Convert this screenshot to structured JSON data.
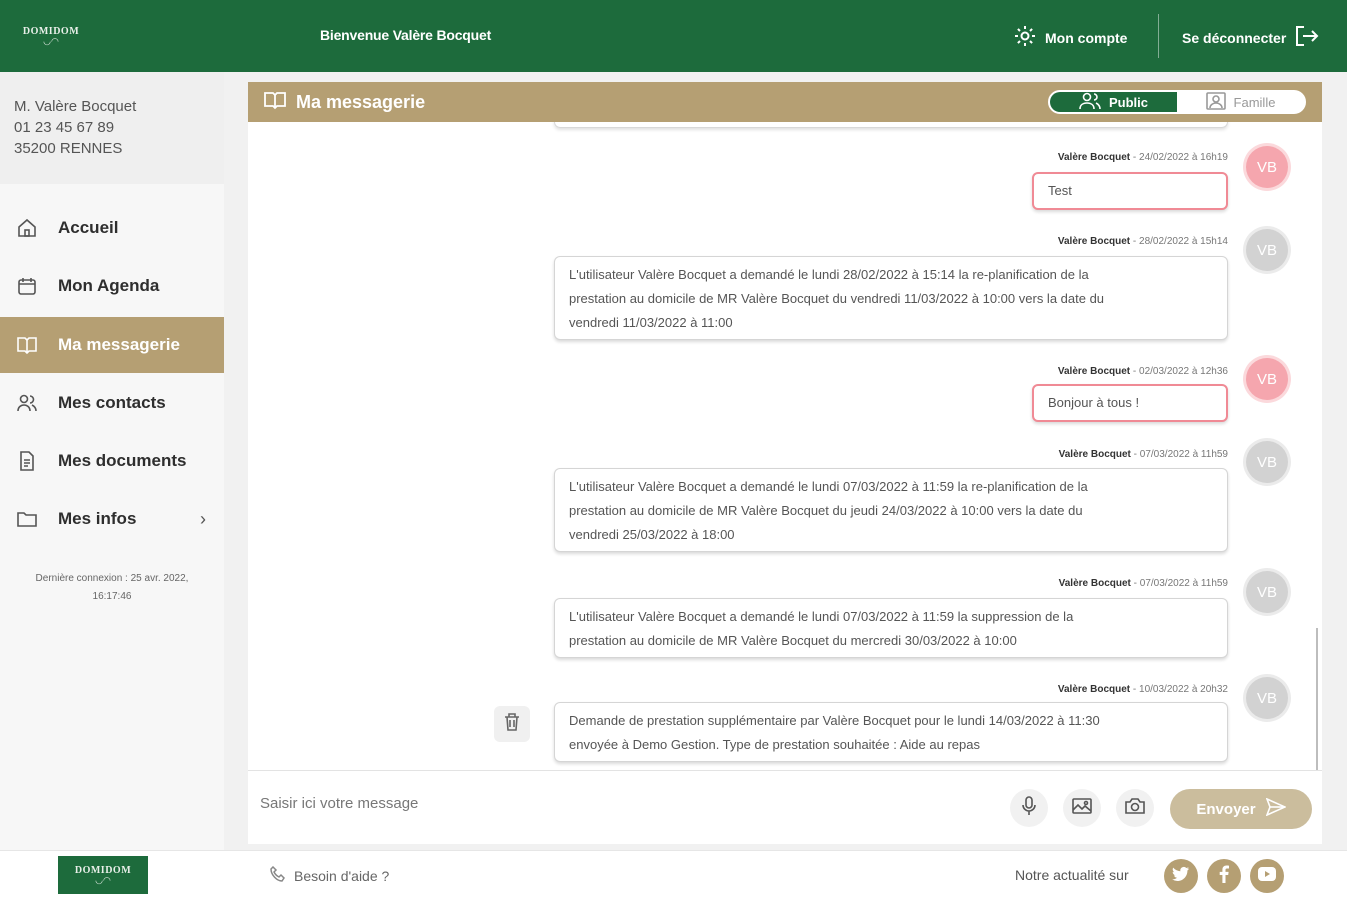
{
  "header": {
    "logo_text": "DOMIDOM",
    "welcome": "Bienvenue Valère Bocquet",
    "account_label": "Mon compte",
    "logout_label": "Se déconnecter"
  },
  "user": {
    "name": "M. Valère Bocquet",
    "phone": "01 23 45 67 89",
    "city": "35200 RENNES"
  },
  "nav": {
    "items": [
      {
        "label": "Accueil",
        "icon": "home-icon"
      },
      {
        "label": "Mon Agenda",
        "icon": "calendar-icon"
      },
      {
        "label": "Ma messagerie",
        "icon": "book-icon",
        "active": true
      },
      {
        "label": "Mes contacts",
        "icon": "contacts-icon"
      },
      {
        "label": "Mes documents",
        "icon": "document-icon"
      },
      {
        "label": "Mes infos",
        "icon": "folder-icon"
      }
    ],
    "last_login_line1": "Dernière connexion : 25 avr. 2022,",
    "last_login_line2": "16:17:46"
  },
  "messaging": {
    "title": "Ma messagerie",
    "toggle_public": "Public",
    "toggle_family": "Famille",
    "messages": [
      {
        "author": "Valère Bocquet",
        "date": "24/02/2022 à 16h19",
        "text": "Test",
        "avatar": "VB"
      },
      {
        "author": "Valère Bocquet",
        "date": "28/02/2022 à 15h14",
        "text_lines": [
          "L'utilisateur Valère Bocquet a demandé le lundi 28/02/2022 à 15:14 la re-planification de la",
          "prestation au domicile de MR Valère Bocquet du vendredi 11/03/2022 à 10:00 vers la date du",
          "vendredi 11/03/2022 à 11:00"
        ],
        "avatar": "VB"
      },
      {
        "author": "Valère Bocquet",
        "date": "02/03/2022 à 12h36",
        "text": "Bonjour à tous !",
        "avatar": "VB"
      },
      {
        "author": "Valère Bocquet",
        "date": "07/03/2022 à 11h59",
        "text_lines": [
          "L'utilisateur Valère Bocquet a demandé le lundi 07/03/2022 à 11:59 la re-planification de la",
          "prestation au domicile de MR Valère Bocquet du jeudi 24/03/2022 à 10:00 vers la date du",
          "vendredi 25/03/2022 à 18:00"
        ],
        "avatar": "VB"
      },
      {
        "author": "Valère Bocquet",
        "date": "07/03/2022 à 11h59",
        "text_lines": [
          "L'utilisateur Valère Bocquet a demandé le lundi 07/03/2022 à 11:59 la suppression de la",
          "prestation au domicile de MR Valère Bocquet du mercredi 30/03/2022 à 10:00"
        ],
        "avatar": "VB"
      },
      {
        "author": "Valère Bocquet",
        "date": "10/03/2022 à 20h32",
        "text_lines": [
          "Demande de prestation supplémentaire par Valère Bocquet pour le lundi 14/03/2022 à 11:30",
          "envoyée à Demo Gestion. Type de prestation souhaitée : Aide au repas"
        ],
        "avatar": "VB"
      }
    ],
    "composer_placeholder": "Saisir ici votre message",
    "send_label": "Envoyer"
  },
  "footer": {
    "logo_text": "DOMIDOM",
    "help_label": "Besoin d'aide ?",
    "news_label": "Notre actualité sur"
  },
  "colors": {
    "brand_green": "#1d6b3c",
    "gold": "#b59f73",
    "pink_accent": "#f08a95"
  }
}
